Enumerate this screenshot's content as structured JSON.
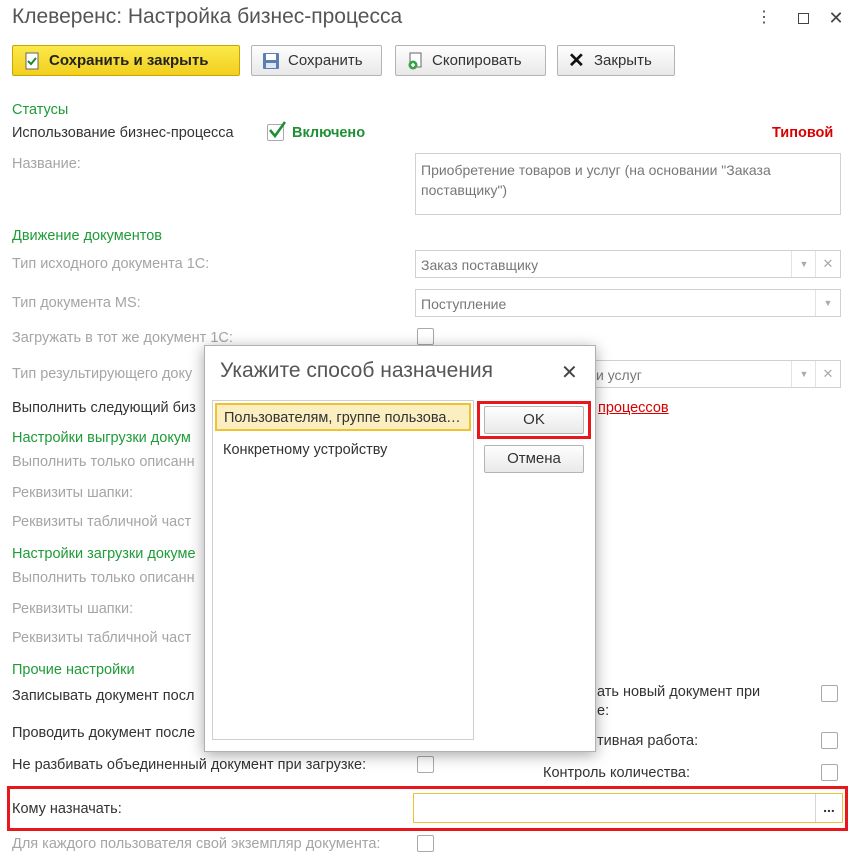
{
  "window": {
    "title": "Клеверенс: Настройка бизнес-процесса",
    "menu_icon": "kebab-icon",
    "maximize_icon": "maximize-icon",
    "close_icon": "close-icon"
  },
  "toolbar": {
    "save_close": "Сохранить и закрыть",
    "save": "Сохранить",
    "copy": "Скопировать",
    "close": "Закрыть"
  },
  "form": {
    "statuses_title": "Статусы",
    "usage_label": "Использование бизнес-процесса",
    "usage_value": "Включено",
    "typical": "Типовой",
    "name_label": "Название:",
    "name_value": "Приобретение товаров и услуг (на основании \"Заказа поставщику\")",
    "docs_title": "Движение документов",
    "src_doc_label": "Тип исходного документа 1С:",
    "src_doc_value": "Заказ поставщику",
    "ms_doc_label": "Тип документа MS:",
    "ms_doc_value": "Поступление",
    "load_same_label": "Загружать в тот же документ 1С:",
    "result_doc_label": "Тип результирующего доку",
    "result_doc_value": "и услуг",
    "next_bp_label": "Выполнить следующий биз",
    "next_bp_link": "процессов",
    "upload_title": "Настройки выгрузки докум",
    "upload_only_label": "Выполнить только описанн",
    "upload_header_label": "Реквизиты шапки:",
    "upload_table_label": "Реквизиты табличной част",
    "download_title": "Настройки загрузки докуме",
    "download_only_label": "Выполнить только описанн",
    "download_header_label": "Реквизиты шапки:",
    "download_table_label": "Реквизиты табличной част",
    "other_title": "Прочие настройки",
    "write_doc_label": "Записывать документ посл",
    "post_doc_label": "Проводить документ после",
    "no_split_label": "Не разбивать объединенный документ при загрузке:",
    "new_doc_label_1": "ать новый документ при",
    "new_doc_label_2": "е:",
    "collab_label": "тивная работа:",
    "qty_control_label": "Контроль количества:",
    "assign_label": "Кому назначать:",
    "assign_value": "",
    "assign_btn": "...",
    "per_user_label": "Для каждого пользователя свой экземпляр документа:"
  },
  "dialog": {
    "title": "Укажите способ назначения",
    "close_icon": "close-icon",
    "options": [
      "Пользователям, группе пользователей",
      "Конкретному устройству"
    ],
    "selected_index": 0,
    "ok": "OK",
    "cancel": "Отмена"
  },
  "colors": {
    "section_green": "#1f9b38",
    "highlight_red": "#e8171e",
    "primary_yellow": "#f5d62a",
    "link_red": "#d90000"
  }
}
